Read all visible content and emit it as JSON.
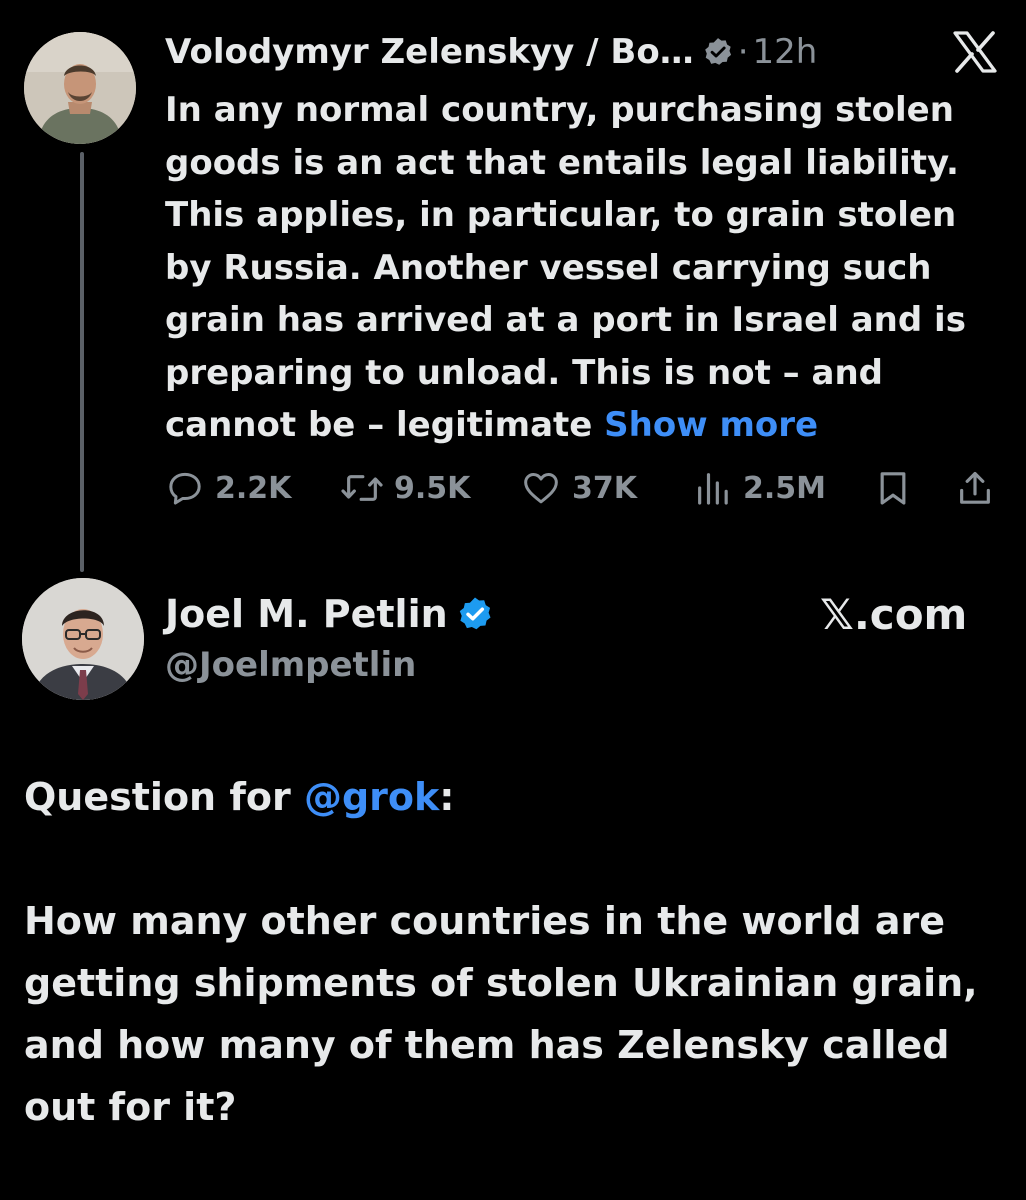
{
  "quoted_tweet": {
    "author_name": "Volodymyr Zelenskyy / Bo…",
    "separator": "·",
    "time_ago": "12h",
    "text": "In any normal country, purchasing stolen goods is an act that entails legal liability. This applies, in particular, to grain stolen by Russia. Another vessel carrying such grain has arrived at a port in Israel and is preparing to unload. This is not – and cannot be – legitimate",
    "show_more": "Show more",
    "stats": {
      "replies": "2.2K",
      "reposts": "9.5K",
      "likes": "37K",
      "views": "2.5M"
    },
    "icons": {
      "verified": "verified-gray-badge-icon",
      "brand": "x-logo-icon",
      "reply": "speech-bubble-icon",
      "repost": "repost-arrows-icon",
      "like": "heart-icon",
      "views": "bar-chart-icon",
      "bookmark": "bookmark-icon",
      "share": "share-upload-icon"
    }
  },
  "reply_tweet": {
    "author_name": "Joel M. Petlin",
    "handle": "@Joelmpetlin",
    "brand_label": "𝕏.com",
    "verified_icon": "verified-blue-badge-icon",
    "text_prefix": "Question for ",
    "mention": "@grok",
    "text_colon": ":",
    "question": "How many other countries in the world are getting shipments of stolen Ukrainian grain, and how many of them has Zelensky called out for it?"
  },
  "colors": {
    "background": "#000000",
    "text_primary": "#e7e9ea",
    "text_secondary": "#8b9299",
    "link_blue": "#3e8ef7",
    "verified_blue": "#1d9bf0",
    "verified_gray": "#8b9299",
    "thread_line": "#5b6067"
  }
}
